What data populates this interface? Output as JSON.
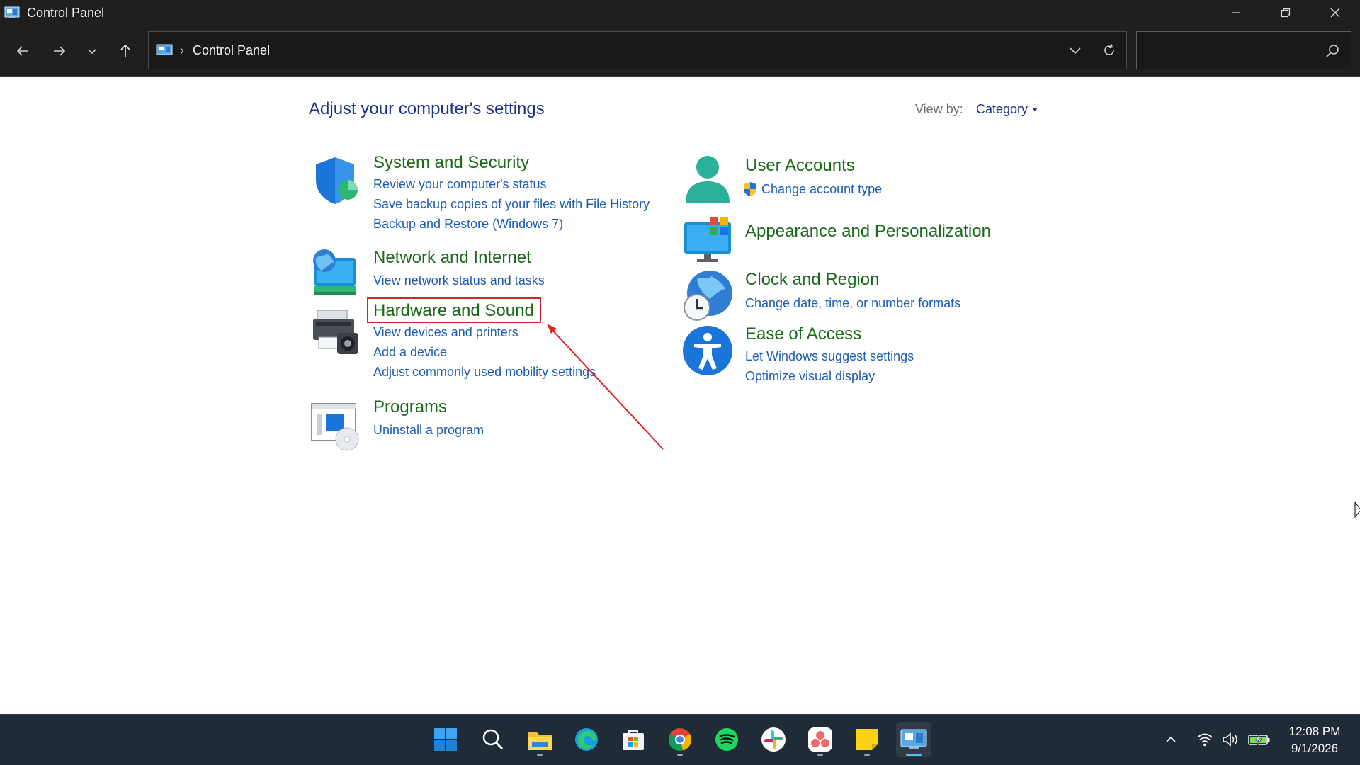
{
  "window": {
    "title": "Control Panel"
  },
  "address": {
    "crumb": "Control Panel",
    "separator": "›"
  },
  "search": {
    "placeholder": ""
  },
  "content": {
    "page_title": "Adjust your computer's settings",
    "view_by_label": "View by:",
    "view_by_value": "Category"
  },
  "categories": {
    "system": {
      "title": "System and Security",
      "links": [
        "Review your computer's status",
        "Save backup copies of your files with File History",
        "Backup and Restore (Windows 7)"
      ]
    },
    "network": {
      "title": "Network and Internet",
      "links": [
        "View network status and tasks"
      ]
    },
    "hardware": {
      "title": "Hardware and Sound",
      "links": [
        "View devices and printers",
        "Add a device",
        "Adjust commonly used mobility settings"
      ]
    },
    "programs": {
      "title": "Programs",
      "links": [
        "Uninstall a program"
      ]
    },
    "users": {
      "title": "User Accounts",
      "links": [
        "Change account type"
      ]
    },
    "appearance": {
      "title": "Appearance and Personalization",
      "links": []
    },
    "clock": {
      "title": "Clock and Region",
      "links": [
        "Change date, time, or number formats"
      ]
    },
    "ease": {
      "title": "Ease of Access",
      "links": [
        "Let Windows suggest settings",
        "Optimize visual display"
      ]
    }
  },
  "taskbar": {
    "apps": [
      "start",
      "search",
      "file-explorer",
      "edge",
      "microsoft-store",
      "chrome",
      "spotify",
      "slack",
      "asana",
      "sticky-notes",
      "control-panel"
    ],
    "time": "12:08 PM",
    "date": "9/1/2026"
  },
  "colors": {
    "title_bar": "#1f1f1f",
    "category_title": "#1a6a1a",
    "link": "#1c5bb4",
    "highlight": "#d8232a",
    "taskbar": "#202b38"
  }
}
